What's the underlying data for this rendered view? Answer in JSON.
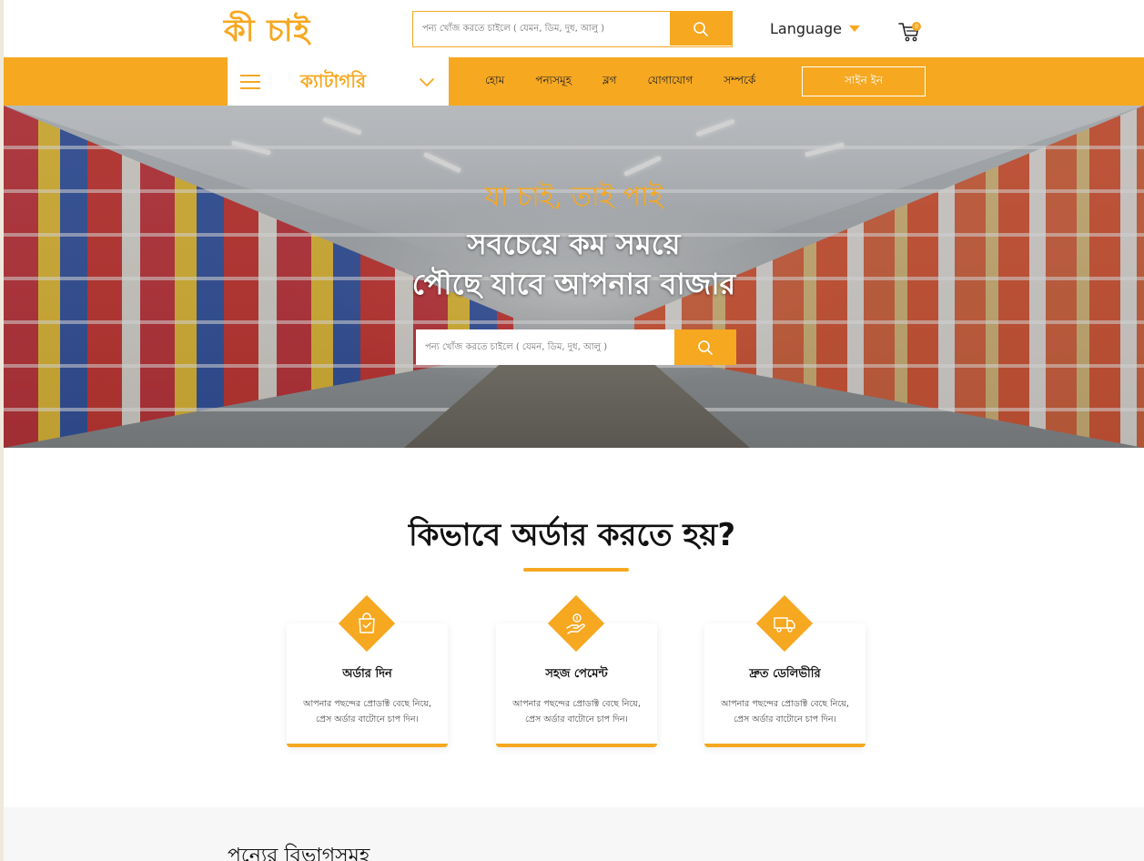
{
  "header": {
    "logo": "কী চাই",
    "search_placeholder": "পন্য খোঁজ করতে চাইলে ( যেমন, ডিম, দুধ, আলু )",
    "language_label": "Language",
    "cart_count": "0"
  },
  "nav": {
    "category_label": "ক্যাটাগরি",
    "links": [
      "হোম",
      "পন্যসমূহ",
      "ব্লগ",
      "যোগাযোগ",
      "সম্পর্কে"
    ],
    "signin_label": "সাইন ইন"
  },
  "hero": {
    "tagline": "যা চাই, তাই পাই",
    "title_line1": "সবচেয়ে কম সময়ে",
    "title_line2": "পৌছে যাবে আপনার বাজার",
    "search_placeholder": "পন্য খোঁজ করতে চাইলে ( যেমন, ডিম, দুধ, আলু )"
  },
  "how_to_order": {
    "title": "কিভাবে অর্ডার করতে হয়?",
    "steps": [
      {
        "icon": "shopping-bag-icon",
        "title": "অর্ডার দিন",
        "desc_line1": "আপনার পছন্দের প্রোডাক্ট বেছে নিয়ে,",
        "desc_line2": "প্রেস অর্ডার বাটোনে চাপ দিন।"
      },
      {
        "icon": "hand-coin-icon",
        "title": "সহজ পেমেন্ট",
        "desc_line1": "আপনার পছন্দের প্রোডাক্ট বেছে নিয়ে,",
        "desc_line2": "প্রেস অর্ডার বাটোনে চাপ দিন।"
      },
      {
        "icon": "delivery-truck-icon",
        "title": "দ্রুত ডেলিভীরি",
        "desc_line1": "আপনার পছন্দের প্রোডাক্ট বেছে নিয়ে,",
        "desc_line2": "প্রেস অর্ডার বাটোনে চাপ দিন।"
      }
    ]
  },
  "categories_section": {
    "title": "পন্যের বিভাগসমূহ"
  },
  "colors": {
    "accent": "#f6a821",
    "text": "#111111",
    "white": "#ffffff"
  }
}
